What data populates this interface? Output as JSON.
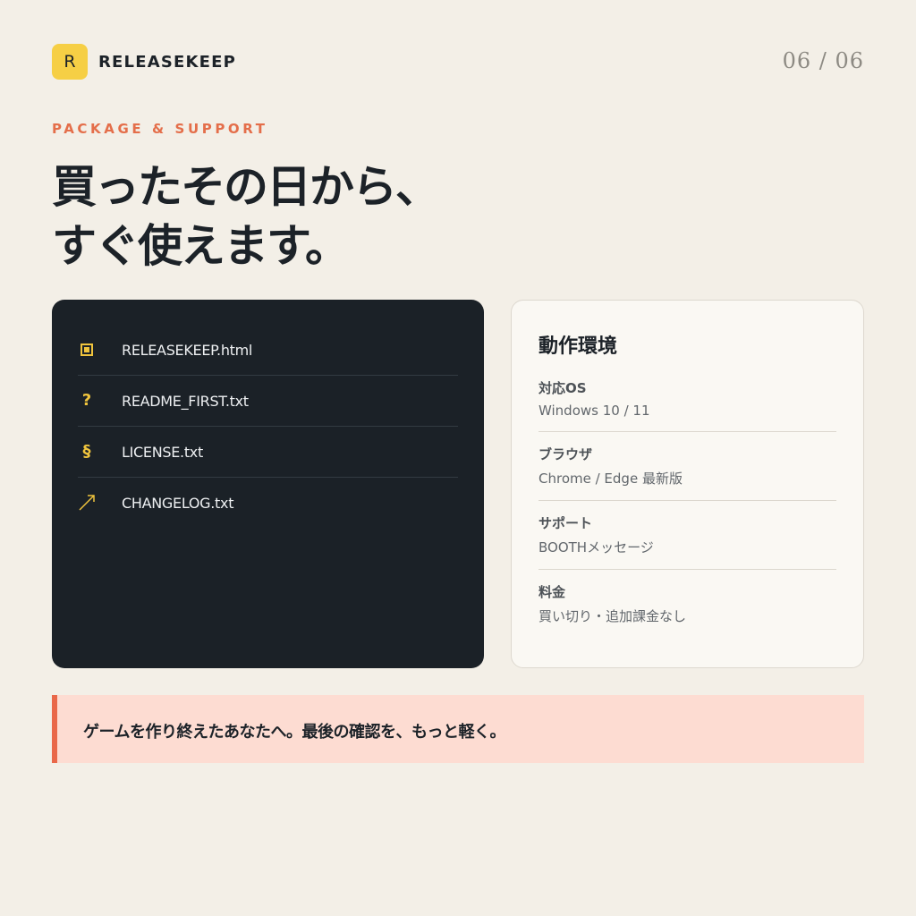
{
  "header": {
    "logo_letter": "R",
    "brand": "RELEASEKEEP",
    "page_indicator": "06 / 06"
  },
  "eyebrow": "PACKAGE & SUPPORT",
  "title": {
    "line1": "買ったその日から、",
    "line2": "すぐ使えます。"
  },
  "files": [
    {
      "icon": "square-icon",
      "name": "RELEASEKEEP.html"
    },
    {
      "icon": "question-icon",
      "glyph": "?",
      "name": "README_FIRST.txt"
    },
    {
      "icon": "section-icon",
      "glyph": "§",
      "name": "LICENSE.txt"
    },
    {
      "icon": "arrow-up-right-icon",
      "name": "CHANGELOG.txt"
    }
  ],
  "environment": {
    "title": "動作環境",
    "items": [
      {
        "label": "対応OS",
        "value": "Windows 10 / 11"
      },
      {
        "label": "ブラウザ",
        "value": "Chrome / Edge 最新版"
      },
      {
        "label": "サポート",
        "value": "BOOTHメッセージ"
      },
      {
        "label": "料金",
        "value": "買い切り・追加課金なし"
      }
    ]
  },
  "callout": "ゲームを作り終えたあなたへ。最後の確認を、もっと軽く。",
  "colors": {
    "background": "#f3efe7",
    "accent_yellow": "#f6cf45",
    "accent_orange": "#e46e4a",
    "dark_card": "#1b2127",
    "callout_bg": "#fddcd2"
  }
}
